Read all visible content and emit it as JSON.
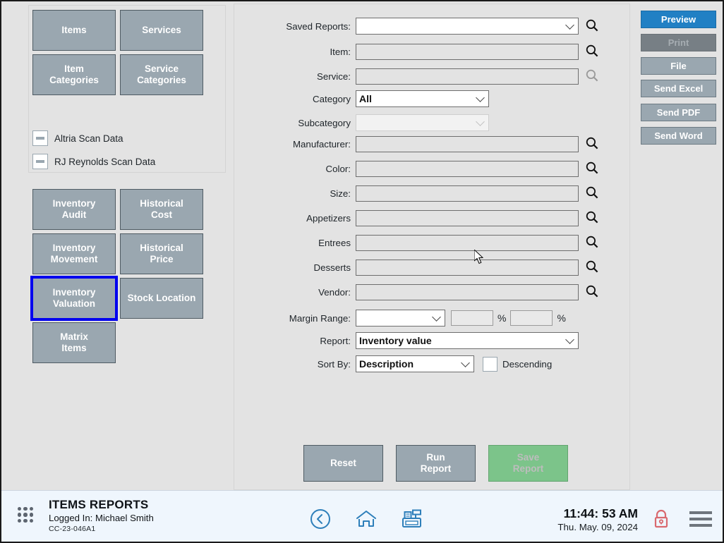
{
  "left_nav": {
    "top_buttons": [
      {
        "id": "items",
        "label": "Items"
      },
      {
        "id": "services",
        "label": "Services"
      },
      {
        "id": "item-categories",
        "label": "Item\nCategories"
      },
      {
        "id": "service-categories",
        "label": "Service\nCategories"
      }
    ],
    "scan_data": [
      {
        "id": "altria",
        "label": "Altria Scan Data",
        "state": "indeterminate"
      },
      {
        "id": "rj-reynolds",
        "label": "RJ Reynolds Scan Data",
        "state": "indeterminate"
      }
    ],
    "report_buttons": [
      {
        "id": "inventory-audit",
        "label": "Inventory\nAudit",
        "selected": false
      },
      {
        "id": "historical-cost",
        "label": "Historical\nCost",
        "selected": false
      },
      {
        "id": "inventory-movement",
        "label": "Inventory\nMovement",
        "selected": false
      },
      {
        "id": "historical-price",
        "label": "Historical\nPrice",
        "selected": false
      },
      {
        "id": "inventory-valuation",
        "label": "Inventory\nValuation",
        "selected": true
      },
      {
        "id": "stock-location",
        "label": "Stock Location",
        "selected": false
      },
      {
        "id": "matrix-items",
        "label": "Matrix\nItems",
        "selected": false
      }
    ],
    "selection_highlight_color": "#0000ee"
  },
  "form": {
    "saved_reports": {
      "label": "Saved Reports:",
      "value": "",
      "enabled": true
    },
    "item": {
      "label": "Item:",
      "value": "",
      "enabled": false
    },
    "service": {
      "label": "Service:",
      "value": "",
      "enabled": false
    },
    "category": {
      "label": "Category",
      "value": "All",
      "enabled": true
    },
    "subcategory": {
      "label": "Subcategory",
      "value": "",
      "enabled": false
    },
    "manufacturer": {
      "label": "Manufacturer:",
      "value": "",
      "enabled": false
    },
    "color": {
      "label": "Color:",
      "value": "",
      "enabled": false
    },
    "size": {
      "label": "Size:",
      "value": "",
      "enabled": false
    },
    "appetizers": {
      "label": "Appetizers",
      "value": "",
      "enabled": false
    },
    "entrees": {
      "label": "Entrees",
      "value": "",
      "enabled": false
    },
    "desserts": {
      "label": "Desserts",
      "value": "",
      "enabled": false
    },
    "vendor": {
      "label": "Vendor:",
      "value": "",
      "enabled": false
    },
    "margin_range": {
      "label": "Margin Range:",
      "operator_value": "",
      "from_value": "",
      "to_value": "",
      "unit_from": "%",
      "unit_to": "%"
    },
    "report": {
      "label": "Report:",
      "value": "Inventory value"
    },
    "sort_by": {
      "label": "Sort By:",
      "value": "Description"
    },
    "descending": {
      "label": "Descending",
      "checked": false
    },
    "search_icon_name": "search-icon"
  },
  "form_actions": {
    "reset": "Reset",
    "run_report": "Run\nReport",
    "save_report": "Save\nReport",
    "save_report_enabled": false,
    "save_report_color": "#7cc48a"
  },
  "right_actions": [
    {
      "id": "preview",
      "label": "Preview",
      "accent": "#2180c4",
      "enabled": true
    },
    {
      "id": "print",
      "label": "Print",
      "accent": "#777f85",
      "enabled": false
    },
    {
      "id": "file",
      "label": "File",
      "accent": "#9aa7b0",
      "enabled": true
    },
    {
      "id": "send-excel",
      "label": "Send Excel",
      "accent": "#9aa7b0",
      "enabled": true
    },
    {
      "id": "send-pdf",
      "label": "Send PDF",
      "accent": "#9aa7b0",
      "enabled": true
    },
    {
      "id": "send-word",
      "label": "Send Word",
      "accent": "#9aa7b0",
      "enabled": true
    }
  ],
  "status_bar": {
    "title": "ITEMS REPORTS",
    "logged_in": "Logged In:  Michael Smith",
    "code": "CC-23-046A1",
    "time": "11:44: 53 AM",
    "date": "Thu. May. 09, 2024",
    "icons": {
      "apps": "grid-icon",
      "back": "back-arrow-icon",
      "home": "home-icon",
      "register": "cash-register-icon",
      "lock": "lock-icon",
      "menu": "hamburger-menu-icon"
    },
    "lock_color": "#d9696f",
    "icon_color": "#2e7fba"
  }
}
